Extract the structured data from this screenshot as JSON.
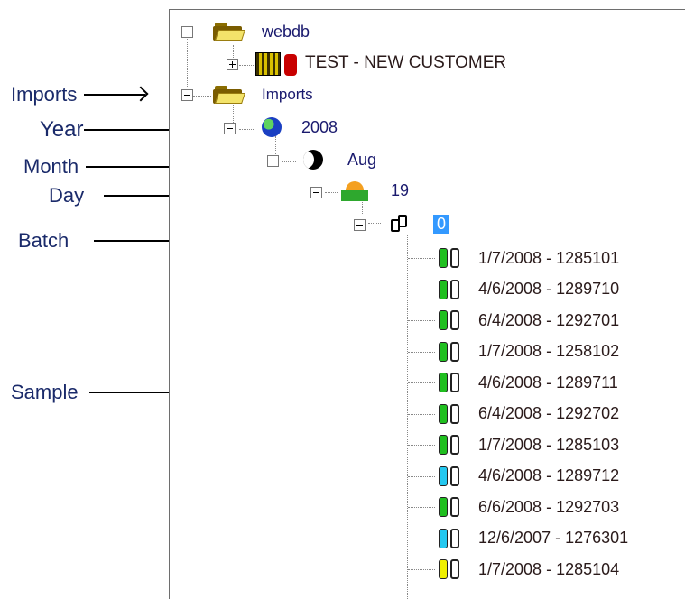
{
  "annotations": {
    "imports": "Imports",
    "year": "Year",
    "month": "Month",
    "day": "Day",
    "batch": "Batch",
    "sample": "Sample"
  },
  "tree": {
    "root": {
      "label": "webdb",
      "icon": "folder-icon",
      "expanded": true
    },
    "customer": {
      "label": "TEST - NEW CUSTOMER",
      "icon": "building-icon",
      "expanded": false
    },
    "imports": {
      "label": "Imports",
      "icon": "folder-icon",
      "expanded": true
    },
    "year": {
      "label": "2008",
      "icon": "globe-icon",
      "expanded": true
    },
    "month": {
      "label": "Aug",
      "icon": "moon-icon",
      "expanded": true
    },
    "day": {
      "label": "19",
      "icon": "sunrise-icon",
      "expanded": true
    },
    "batch": {
      "label": "0",
      "icon": "batch-icon",
      "expanded": true,
      "selected": true
    },
    "samples": [
      {
        "label": "1/7/2008 - 1285101",
        "color": "#1fbf1f"
      },
      {
        "label": "4/6/2008 - 1289710",
        "color": "#1fbf1f"
      },
      {
        "label": "6/4/2008 - 1292701",
        "color": "#1fbf1f"
      },
      {
        "label": "1/7/2008 - 1258102",
        "color": "#1fbf1f"
      },
      {
        "label": "4/6/2008 - 1289711",
        "color": "#1fbf1f"
      },
      {
        "label": "6/4/2008 - 1292702",
        "color": "#1fbf1f"
      },
      {
        "label": "1/7/2008 - 1285103",
        "color": "#1fbf1f"
      },
      {
        "label": "4/6/2008 - 1289712",
        "color": "#24c8f0"
      },
      {
        "label": "6/6/2008 - 1292703",
        "color": "#1fbf1f"
      },
      {
        "label": "12/6/2007 - 1276301",
        "color": "#24c8f0"
      },
      {
        "label": "1/7/2008 - 1285104",
        "color": "#f0f000"
      }
    ]
  }
}
